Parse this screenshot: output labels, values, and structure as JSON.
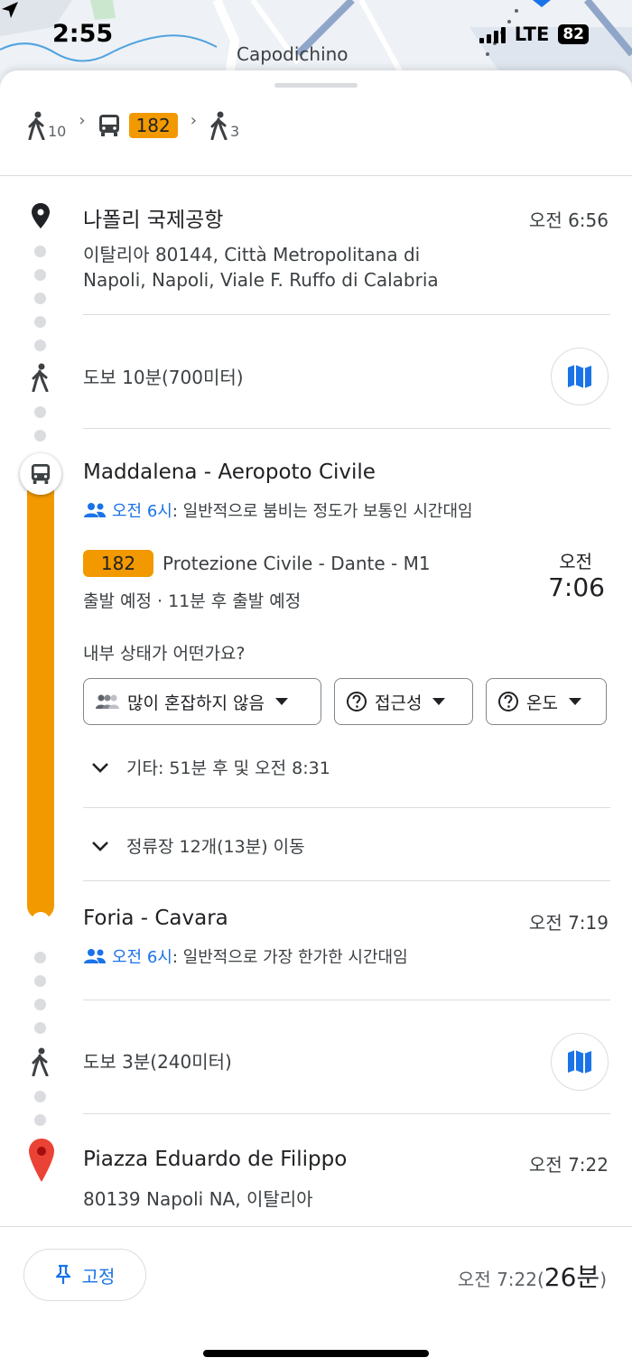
{
  "status_bar": {
    "time": "2:55",
    "network": "LTE",
    "battery": "82"
  },
  "map": {
    "place_label": "Capodichino"
  },
  "summary": {
    "walk_start": "10",
    "bus_route": "182",
    "walk_end": "3"
  },
  "origin": {
    "title": "나폴리 국제공항",
    "time": "오전 6:56",
    "address_line1": "이탈리아 80144, Città Metropolitana di",
    "address_line2": "Napoli, Napoli, Viale F. Ruffo di Calabria"
  },
  "walk1": {
    "text": "도보 10분(700미터)"
  },
  "board_stop": {
    "title": "Maddalena - Aeropoto Civile",
    "crowd_time": "오전 6시",
    "crowd_text": ": 일반적으로 붐비는 정도가 보통인 시간대임"
  },
  "bus": {
    "route": "182",
    "headsign": "Protezione Civile - Dante - M1",
    "dep_ampm": "오전",
    "dep_time": "7:06",
    "status": "출발 예정 · 11분 후 출발 예정"
  },
  "feedback": {
    "question": "내부 상태가 어떤가요?",
    "chip1": "많이 혼잡하지 않음",
    "chip2": "접근성",
    "chip3": "온도"
  },
  "other": {
    "text": "기타: 51분 후 및 오전 8:31"
  },
  "stops": {
    "text": "정류장 12개(13분) 이동"
  },
  "alight_stop": {
    "title": "Foria - Cavara",
    "time": "오전 7:19",
    "crowd_time": "오전 6시",
    "crowd_text": ": 일반적으로 가장 한가한 시간대임"
  },
  "walk2": {
    "text": "도보 3분(240미터)"
  },
  "destination": {
    "title": "Piazza Eduardo de Filippo",
    "time": "오전 7:22",
    "address": "80139 Napoli NA, 이탈리아"
  },
  "footer": {
    "pin_label": "고정",
    "arrival": "오전 7:22(",
    "duration": "26분",
    "close_paren": ")"
  },
  "colors": {
    "bus": "#f29900",
    "accent": "#1a73e8",
    "destination_pin": "#ea4335"
  }
}
